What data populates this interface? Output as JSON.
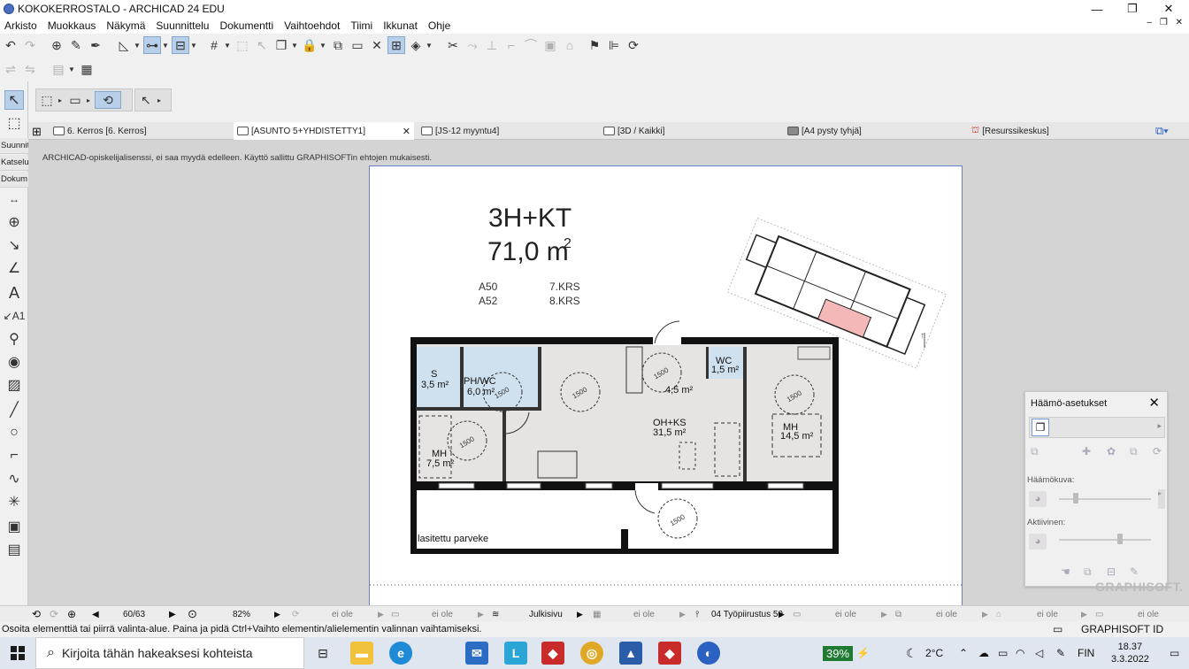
{
  "window": {
    "title": "KOKOKERROSTALO - ARCHICAD 24 EDU",
    "minimize": "—",
    "restore": "❐",
    "close": "✕",
    "mdi_controls": "– ❐ ✕"
  },
  "menu": [
    "Arkisto",
    "Muokkaus",
    "Näkymä",
    "Suunnittelu",
    "Dokumentti",
    "Vaihtoehdot",
    "Tiimi",
    "Ikkunat",
    "Ohje"
  ],
  "left_panel_labels": [
    "Suunnit",
    "Katselu",
    "Dokum"
  ],
  "tabs": [
    {
      "label": "6. Kerros [6. Kerros]"
    },
    {
      "label": "[ASUNTO 5+YHDISTETTY1]",
      "close": "✕"
    },
    {
      "label": "[JS-12 myyntu4]"
    },
    {
      "label": "[3D / Kaikki]"
    },
    {
      "label": "[A4 pysty tyhjä]"
    },
    {
      "label": "[Resurssikeskus]"
    }
  ],
  "notice": "ARCHICAD-opiskelijalisenssi, ei saa myydä edelleen. Käyttö sallittu GRAPHISOFTin ehtojen mukaisesti.",
  "plan": {
    "type": "3H+KT",
    "area": "71,0 m",
    "area_sup": "2",
    "apartments": [
      "A50",
      "A52"
    ],
    "floors": [
      "7.KRS",
      "8.KRS"
    ],
    "rooms": [
      {
        "name": "S",
        "area": "3,5 m²"
      },
      {
        "name": "PH/WC",
        "area": "6,0 m²"
      },
      {
        "name": "WC",
        "area": "1,5 m²"
      },
      {
        "name": "",
        "area": "4,5 m²"
      },
      {
        "name": "OH+KS",
        "area": "31,5 m²"
      },
      {
        "name": "MH",
        "area": "14,5 m²"
      },
      {
        "name": "MH",
        "area": "7,5 m²"
      }
    ],
    "balcony": "lasitettu parveke",
    "circle_label": "1500"
  },
  "palette": {
    "title": "Häämö-asetukset",
    "close": "✕",
    "label_ghost": "Häämökuva:",
    "label_active": "Aktiivinen:",
    "brand": "GRAPHISOFT."
  },
  "status": {
    "page": "60/63",
    "zoom": "82%",
    "off1": "ei ole",
    "off2": "ei ole",
    "layer": "Julkisivu",
    "off3": "ei ole",
    "pen": "04 Työpiirustus 50",
    "off4": "ei ole",
    "off5": "ei ole",
    "off6": "ei ole",
    "off7": "ei ole",
    "graphisoft_id": "GRAPHISOFT ID"
  },
  "hint": "Osoita elementtiä tai piirrä valinta-alue. Paina ja pidä Ctrl+Vaihto elementin/alielementin valinnan vaihtamiseksi.",
  "taskbar": {
    "search_placeholder": "Kirjoita tähän hakeaksesi kohteista",
    "battery": "39%",
    "temperature": "2°C",
    "language": "FIN",
    "time": "18.37",
    "date": "3.3.2022"
  },
  "colors": {
    "accent": "#2b62c2",
    "selected_tool": "#b7cfe8",
    "wet_room": "#cfe0ee",
    "highlight": "#f4b8b8",
    "battery_bg": "#1f7a32"
  }
}
